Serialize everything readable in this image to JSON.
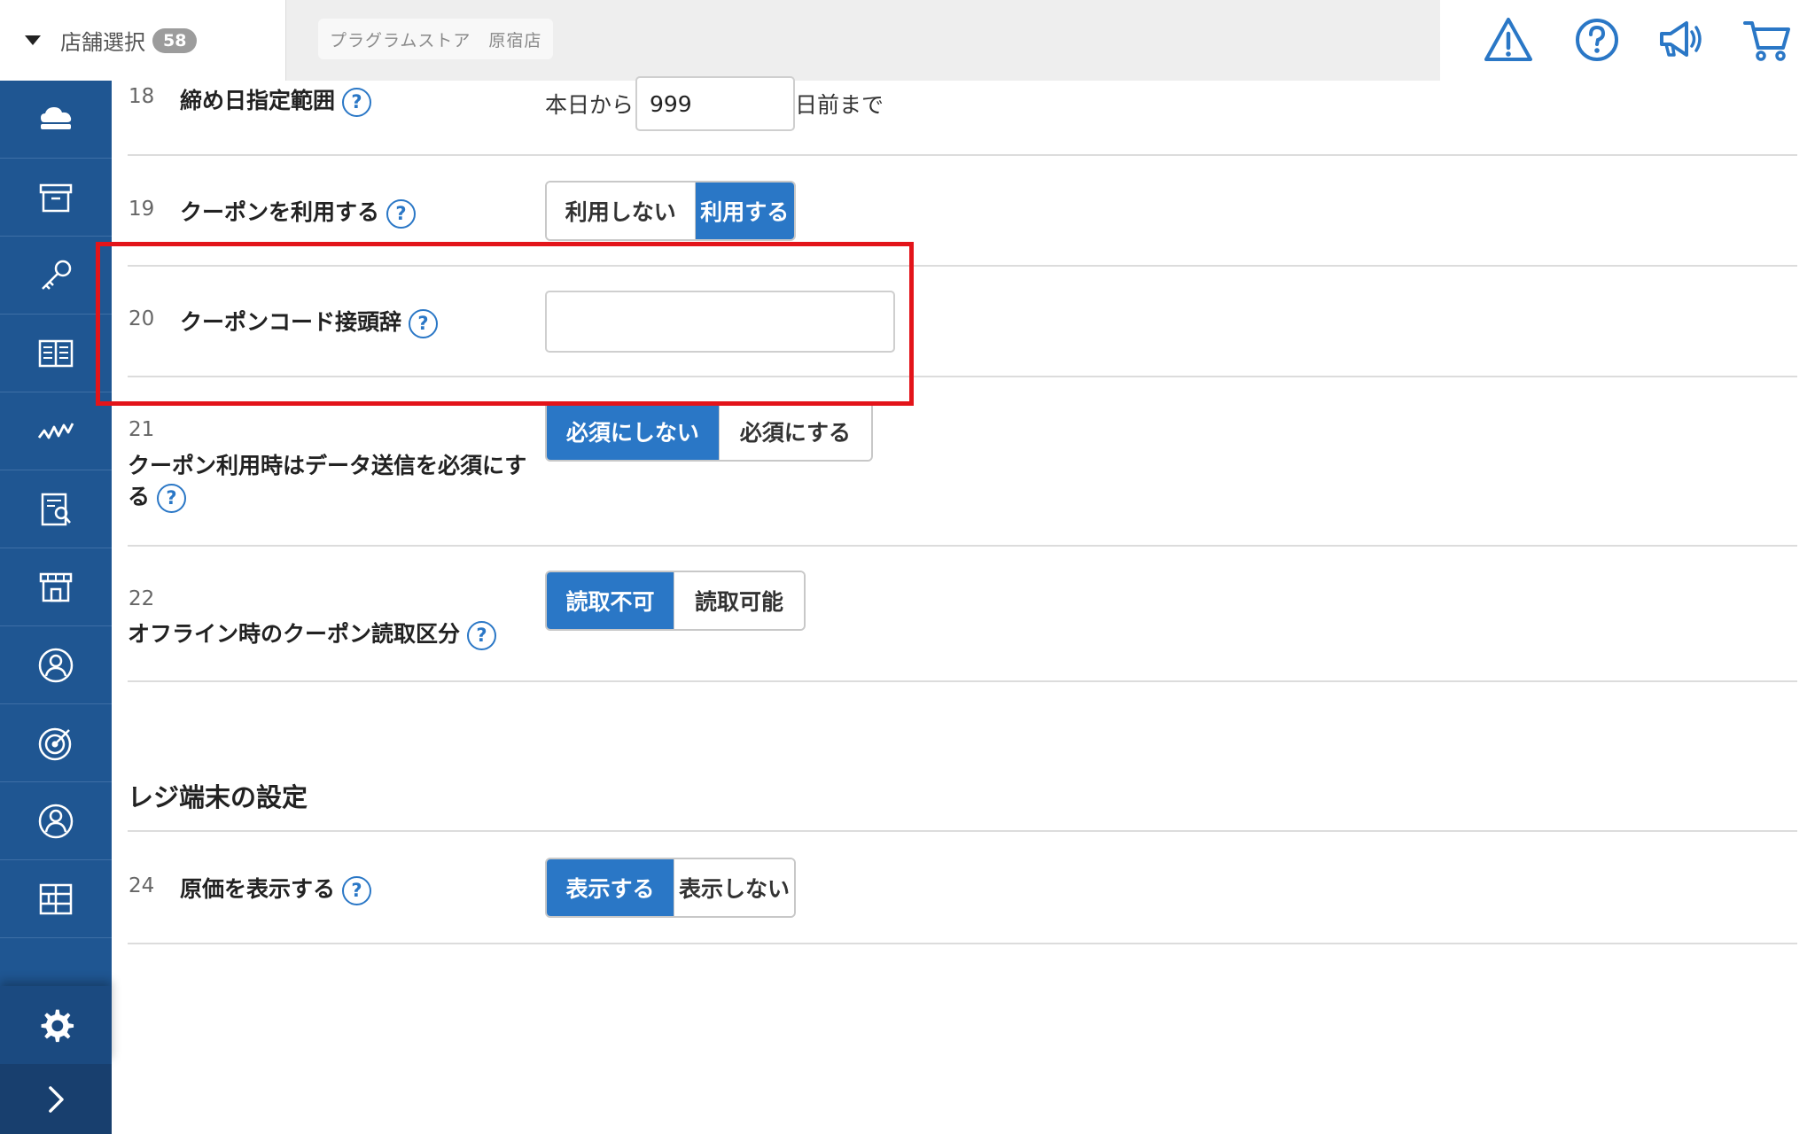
{
  "header": {
    "store_select_label": "店舗選択",
    "store_count": "58",
    "current_store": "プラグラムストア　原宿店",
    "icons": [
      "warning-icon",
      "help-icon",
      "announcement-icon",
      "cart-icon"
    ],
    "accent_color": "#2a77c6"
  },
  "sidebar": {
    "items": [
      "cloud-register-icon",
      "archive-box-icon",
      "key-icon",
      "book-icon",
      "analytics-icon",
      "report-icon",
      "store-icon",
      "customer-icon",
      "target-icon",
      "user-icon",
      "grid-icon"
    ],
    "settings_icon": "gear-icon",
    "expand_icon": "chevron-right-icon",
    "background_color": "#1f5692"
  },
  "settings": {
    "row18": {
      "num": "18",
      "label": "締め日指定範囲",
      "prefix": "本日から",
      "value": "999",
      "suffix": "日前まで"
    },
    "row19": {
      "num": "19",
      "label": "クーポンを利用する",
      "options": [
        "利用しない",
        "利用する"
      ],
      "selected": "利用する"
    },
    "row20": {
      "num": "20",
      "label": "クーポンコード接頭辞",
      "value": ""
    },
    "row21": {
      "num": "21",
      "label_line1": "クーポン利用時はデータ送信を必須にす",
      "label_line2": "る",
      "options": [
        "必須にしない",
        "必須にする"
      ],
      "selected": "必須にしない"
    },
    "row22": {
      "num": "22",
      "label": "オフライン時のクーポン読取区分",
      "options": [
        "読取不可",
        "読取可能"
      ],
      "selected": "読取不可"
    },
    "register_section_title": "レジ端末の設定",
    "row24": {
      "num": "24",
      "label": "原価を表示する",
      "options": [
        "表示する",
        "表示しない"
      ],
      "selected": "表示する"
    },
    "help_glyph": "?"
  },
  "annotation": {
    "highlight_color": "#e3141a"
  }
}
